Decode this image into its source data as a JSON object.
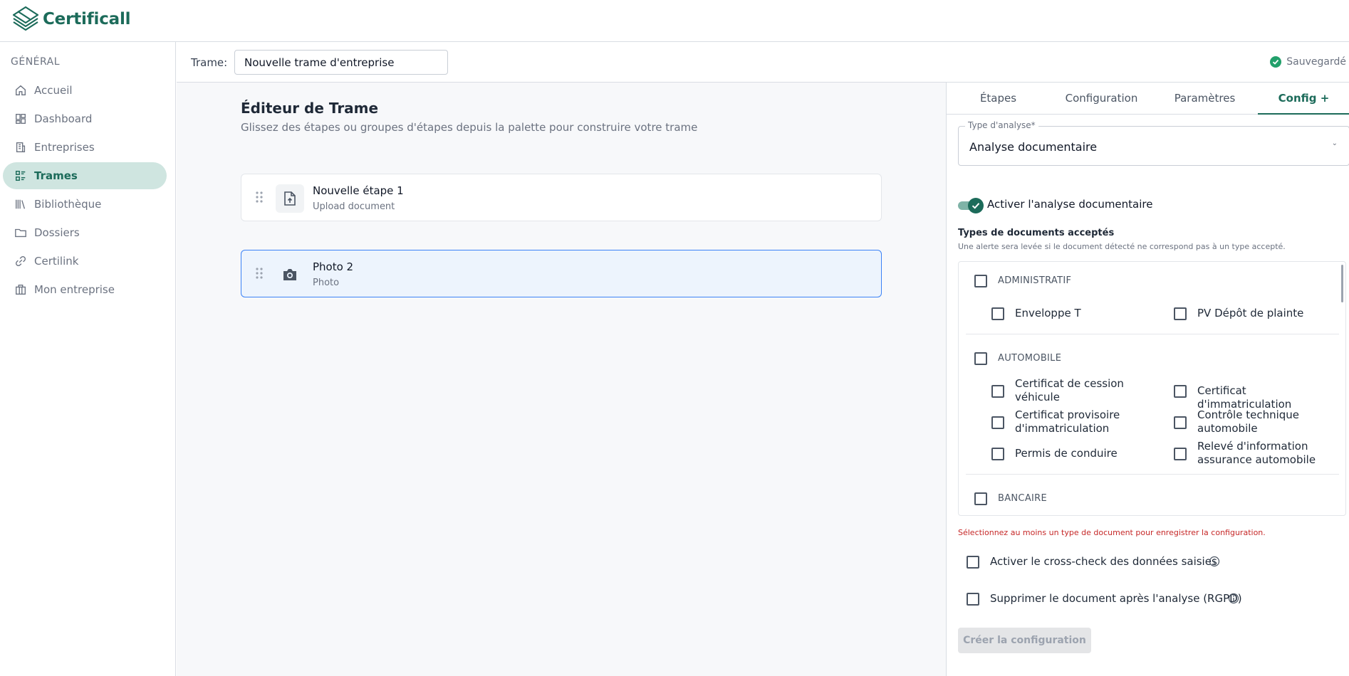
{
  "app": {
    "name": "Certificall"
  },
  "sidebar": {
    "section": "GÉNÉRAL",
    "items": [
      {
        "label": "Accueil",
        "icon": "home-icon"
      },
      {
        "label": "Dashboard",
        "icon": "dashboard-icon"
      },
      {
        "label": "Entreprises",
        "icon": "building-icon"
      },
      {
        "label": "Trames",
        "icon": "list-icon",
        "active": true
      },
      {
        "label": "Bibliothèque",
        "icon": "library-icon"
      },
      {
        "label": "Dossiers",
        "icon": "folder-icon"
      },
      {
        "label": "Certilink",
        "icon": "link-icon"
      },
      {
        "label": "Mon entreprise",
        "icon": "briefcase-icon"
      }
    ]
  },
  "header": {
    "trame_label": "Trame:",
    "trame_value": "Nouvelle trame d'entreprise",
    "status": "Sauvegardé"
  },
  "editor": {
    "title": "Éditeur de Trame",
    "subtitle": "Glissez des étapes ou groupes d'étapes depuis la palette pour construire votre trame",
    "steps": [
      {
        "title": "Nouvelle étape 1",
        "type": "Upload document",
        "icon": "file-upload-icon"
      },
      {
        "title": "Photo 2",
        "type": "Photo",
        "icon": "camera-icon",
        "selected": true
      }
    ]
  },
  "panel": {
    "tabs": [
      "Étapes",
      "Configuration",
      "Paramètres",
      "Config +"
    ],
    "active_tab": "Config +",
    "analysis_type_label": "Type d'analyse*",
    "analysis_type_value": "Analyse documentaire",
    "toggle_label": "Activer l'analyse documentaire",
    "toggle_on": true,
    "types_title": "Types de documents acceptés",
    "types_subtitle": "Une alerte sera levée si le document détecté ne correspond pas à un type accepté.",
    "groups": [
      {
        "label": "ADMINISTRATIF",
        "items": [
          "Enveloppe T",
          "PV Dépôt de plainte"
        ]
      },
      {
        "label": "AUTOMOBILE",
        "items": [
          "Certificat de cession véhicule",
          "Certificat d'immatriculation",
          "Certificat provisoire d'immatriculation",
          "Contrôle technique automobile",
          "Permis de conduire",
          "Relevé d'information assurance automobile"
        ]
      },
      {
        "label": "BANCAIRE",
        "items": []
      }
    ],
    "error": "Sélectionnez au moins un type de document pour enregistrer la configuration.",
    "crosscheck_label": "Activer le cross-check des données saisies",
    "rgpd_label": "Supprimer le document après l'analyse (RGPD)",
    "create_button": "Créer la configuration"
  },
  "colors": {
    "brand": "#1c6b5a",
    "active_bg": "#cfe5e0",
    "error": "#c62828",
    "selected_border": "#3b82f6"
  }
}
